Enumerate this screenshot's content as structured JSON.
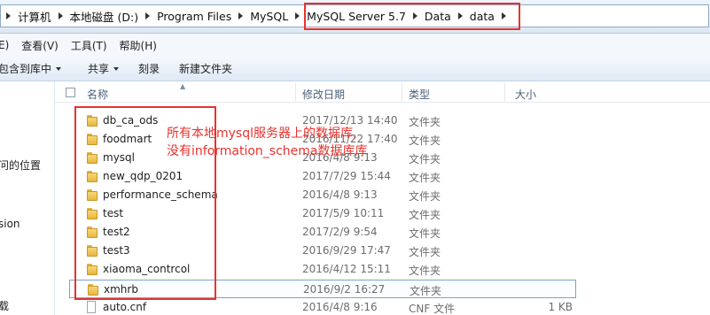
{
  "breadcrumb": {
    "items": [
      "计算机",
      "本地磁盘 (D:)",
      "Program Files",
      "MySQL",
      "MySQL Server 5.7",
      "Data",
      "data"
    ]
  },
  "menu": {
    "items": [
      "E)",
      "查看(V)",
      "工具(T)",
      "帮助(H)"
    ]
  },
  "toolbar": {
    "include_library": "包含到库中",
    "share": "共享",
    "burn": "刻录",
    "new_folder": "新建文件夹"
  },
  "nav": {
    "items": [
      "问的位置",
      "sion",
      "载"
    ]
  },
  "columns": {
    "name": "名称",
    "date": "修改日期",
    "type": "类型",
    "size": "大小"
  },
  "rows": [
    {
      "name": "db_ca_ods",
      "date": "2017/12/13 14:40",
      "type": "文件夹",
      "size": ""
    },
    {
      "name": "foodmart",
      "date": "2016/11/22 17:40",
      "type": "文件夹",
      "size": ""
    },
    {
      "name": "mysql",
      "date": "2016/4/8 9:13",
      "type": "文件夹",
      "size": ""
    },
    {
      "name": "new_qdp_0201",
      "date": "2017/7/29 15:44",
      "type": "文件夹",
      "size": ""
    },
    {
      "name": "performance_schema",
      "date": "2016/4/8 9:13",
      "type": "文件夹",
      "size": ""
    },
    {
      "name": "test",
      "date": "2017/5/9 10:11",
      "type": "文件夹",
      "size": ""
    },
    {
      "name": "test2",
      "date": "2017/2/9 9:54",
      "type": "文件夹",
      "size": ""
    },
    {
      "name": "test3",
      "date": "2016/9/29 17:47",
      "type": "文件夹",
      "size": ""
    },
    {
      "name": "xiaoma_contrcol",
      "date": "2016/4/12 15:11",
      "type": "文件夹",
      "size": ""
    },
    {
      "name": "xmhrb",
      "date": "2016/9/2 16:27",
      "type": "文件夹",
      "size": ""
    },
    {
      "name": "auto.cnf",
      "date": "2016/4/8 9:16",
      "type": "CNF 文件",
      "size": "1 KB"
    }
  ],
  "annotation": {
    "line1": "所有本地mysql服务器上的数据库,",
    "line2": "没有information_schema数据库库"
  },
  "colors": {
    "highlight": "#e8322d",
    "folder": "#e8b73f",
    "selection_border": "#7da2ce"
  }
}
